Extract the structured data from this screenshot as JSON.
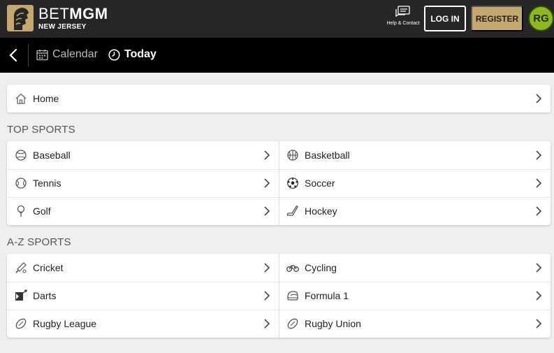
{
  "header": {
    "brand_light": "BET",
    "brand_bold": "MGM",
    "brand_sub": "NEW JERSEY",
    "help_label": "Help & Contact",
    "login_label": "LOG IN",
    "register_label": "REGISTER",
    "rg_label": "RG",
    "accent_color": "#c5a86d"
  },
  "subnav": {
    "calendar_label": "Calendar",
    "today_label": "Today"
  },
  "home": {
    "label": "Home"
  },
  "top_sports": {
    "title": "TOP SPORTS",
    "items": [
      {
        "label": "Baseball",
        "icon": "baseball-icon"
      },
      {
        "label": "Basketball",
        "icon": "basketball-icon"
      },
      {
        "label": "Tennis",
        "icon": "tennis-icon"
      },
      {
        "label": "Soccer",
        "icon": "soccer-icon"
      },
      {
        "label": "Golf",
        "icon": "golf-icon"
      },
      {
        "label": "Hockey",
        "icon": "hockey-icon"
      }
    ]
  },
  "az_sports": {
    "title": "A-Z SPORTS",
    "items": [
      {
        "label": "Cricket",
        "icon": "cricket-icon"
      },
      {
        "label": "Cycling",
        "icon": "cycling-icon"
      },
      {
        "label": "Darts",
        "icon": "darts-icon"
      },
      {
        "label": "Formula 1",
        "icon": "formula1-icon"
      },
      {
        "label": "Rugby League",
        "icon": "rugby-icon"
      },
      {
        "label": "Rugby Union",
        "icon": "rugby-icon"
      }
    ]
  }
}
